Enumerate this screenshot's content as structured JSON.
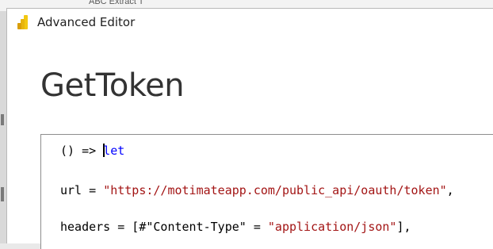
{
  "background": {
    "tab_text": "ABC Extract T"
  },
  "window": {
    "title": "Advanced Editor",
    "icon": "power-bi-logo-icon",
    "accent_color": "#f2c811"
  },
  "query": {
    "name": "GetToken"
  },
  "editor": {
    "lines": [
      {
        "prefix": "() => ",
        "keyword": "let",
        "caret_before_keyword": true
      },
      {
        "prefix": "url = ",
        "string": "\"https://motimateapp.com/public_api/oauth/token\"",
        "suffix": ","
      },
      {
        "prefix": "headers = [#\"Content-Type\" = ",
        "string": "\"application/json\"",
        "suffix": "],"
      }
    ],
    "colors": {
      "keyword": "#0000ff",
      "string": "#a31515",
      "text": "#000000"
    }
  }
}
